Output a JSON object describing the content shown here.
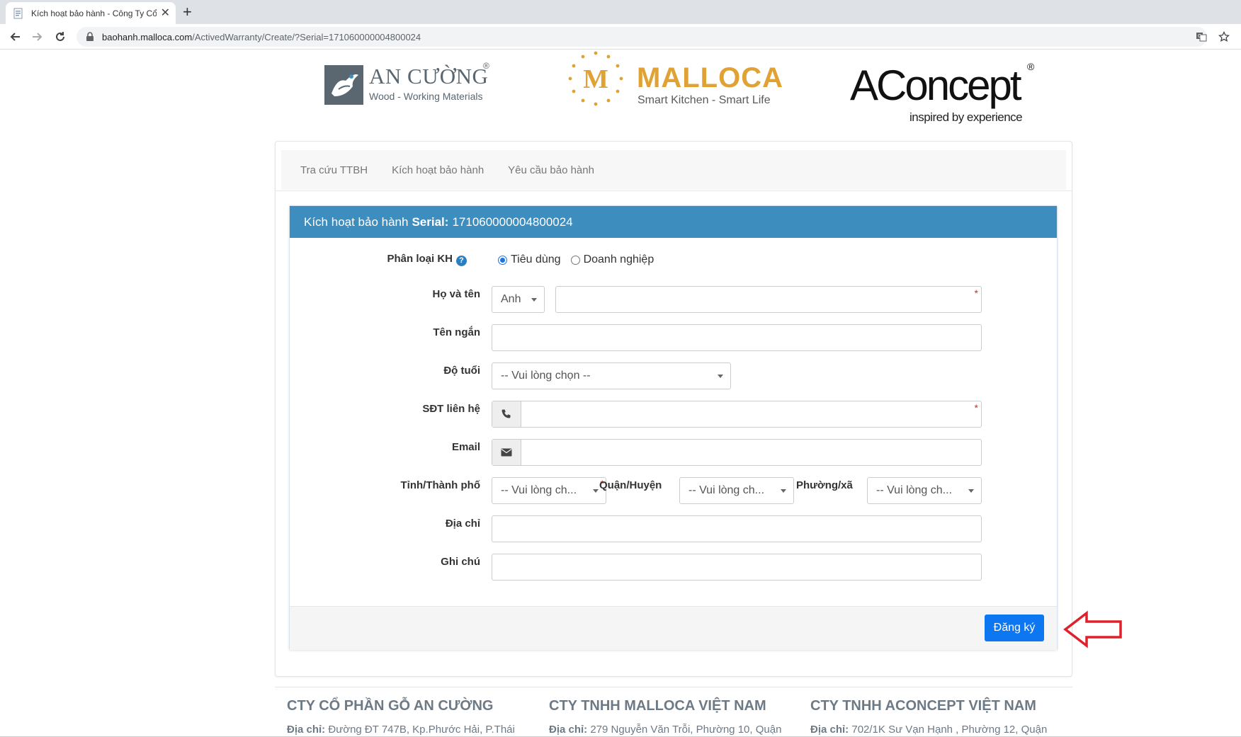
{
  "browser": {
    "tab_title": "Kích hoạt bảo hành - Công Ty Cổ",
    "url_host": "baohanh.malloca.com",
    "url_path": "/ActivedWarranty/Create/?Serial=171060000004800024"
  },
  "logos": {
    "ancuong": {
      "name": "AN CƯỜNG",
      "reg": "®",
      "tagline": "Wood - Working Materials"
    },
    "malloca": {
      "letter": "M",
      "name": "MALLOCA",
      "tagline": "Smart Kitchen - Smart Life"
    },
    "aconcept": {
      "name": "AConcept",
      "reg": "®",
      "tagline": "inspired by experience"
    }
  },
  "nav": {
    "items": [
      "Tra cứu TTBH",
      "Kích hoạt bảo hành",
      "Yêu cầu bảo hành"
    ]
  },
  "panel": {
    "title_prefix": "Kích hoạt bảo hành",
    "serial_label": "Serial:",
    "serial_value": "171060000004800024"
  },
  "form": {
    "customer_type_label": "Phân loại KH",
    "customer_type_options": [
      "Tiêu dùng",
      "Doanh nghiệp"
    ],
    "customer_type_selected": "Tiêu dùng",
    "full_name_label": "Họ và tên",
    "title_select_value": "Anh",
    "short_name_label": "Tên ngắn",
    "age_label": "Độ tuổi",
    "age_select_value": "-- Vui lòng chọn --",
    "phone_label": "SĐT liên hệ",
    "email_label": "Email",
    "province_label": "Tỉnh/Thành phố",
    "province_select_value": "-- Vui lòng ch...",
    "district_label": "Quận/Huyện",
    "district_select_value": "-- Vui lòng ch...",
    "ward_label": "Phường/xã",
    "ward_select_value": "-- Vui lòng ch...",
    "address_label": "Địa chỉ",
    "note_label": "Ghi chú",
    "required_mark": "*",
    "submit_label": "Đăng ký"
  },
  "footer": {
    "companies": [
      {
        "name": "CTY CỔ PHẦN GỖ AN CƯỜNG",
        "addr_label": "Địa chỉ:",
        "addr": "Đường ĐT 747B, Kp.Phước Hải, P.Thái"
      },
      {
        "name": "CTY TNHH MALLOCA VIỆT NAM",
        "addr_label": "Địa chỉ:",
        "addr": "279 Nguyễn Văn Trỗi, Phường 10, Quận"
      },
      {
        "name": "CTY TNHH ACONCEPT VIỆT NAM",
        "addr_label": "Địa chỉ:",
        "addr": "702/1K Sư Vạn Hạnh , Phường 12, Quận"
      }
    ]
  },
  "colors": {
    "panel_header": "#3e8dbf",
    "submit_button": "#0d77f2",
    "required": "#c9302c",
    "annotation_arrow": "#e0202a",
    "malloca_gold": "#e0a234"
  }
}
